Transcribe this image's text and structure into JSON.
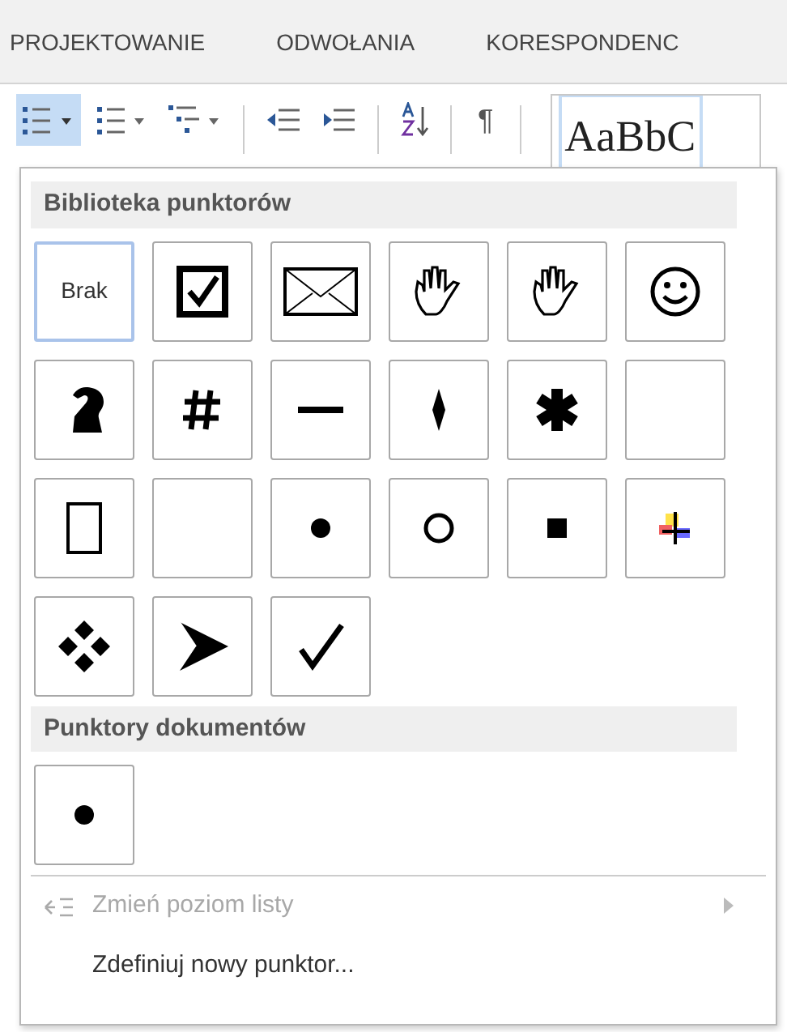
{
  "ribbon_tabs": [
    {
      "label": "PROJEKTOWANIE"
    },
    {
      "label": "ODWOŁANIA"
    },
    {
      "label": "KORESPONDENC"
    }
  ],
  "toolbar": {
    "bullets_selected": true,
    "pilcrow": "¶",
    "style_preview": "AaBbC"
  },
  "bullet_menu": {
    "sections": [
      {
        "title": "Biblioteka punktorów",
        "items": [
          {
            "kind": "none",
            "label": "Brak",
            "selected": true
          },
          {
            "kind": "checkbox",
            "selected": false
          },
          {
            "kind": "envelope",
            "selected": false
          },
          {
            "kind": "hand",
            "selected": false
          },
          {
            "kind": "hand",
            "selected": false
          },
          {
            "kind": "smiley",
            "selected": false
          },
          {
            "kind": "knight",
            "selected": false
          },
          {
            "kind": "hash",
            "selected": false
          },
          {
            "kind": "dash",
            "selected": false
          },
          {
            "kind": "spindle",
            "selected": false
          },
          {
            "kind": "asterisk",
            "selected": false
          },
          {
            "kind": "blank",
            "selected": false
          },
          {
            "kind": "rectangle",
            "selected": false
          },
          {
            "kind": "blank",
            "selected": false
          },
          {
            "kind": "dot",
            "selected": false
          },
          {
            "kind": "circle",
            "selected": false
          },
          {
            "kind": "square",
            "selected": false
          },
          {
            "kind": "color-cross",
            "selected": false
          },
          {
            "kind": "diamonds",
            "selected": false
          },
          {
            "kind": "arrowhead",
            "selected": false
          },
          {
            "kind": "check",
            "selected": false
          }
        ]
      },
      {
        "title": "Punktory dokumentów",
        "items": [
          {
            "kind": "dot",
            "selected": false
          }
        ]
      }
    ],
    "commands": [
      {
        "label": "Zmień poziom listy",
        "disabled": true,
        "submenu": true,
        "icon": true
      },
      {
        "label": "Zdefiniuj nowy punktor...",
        "disabled": false,
        "submenu": false,
        "icon": false
      }
    ]
  }
}
